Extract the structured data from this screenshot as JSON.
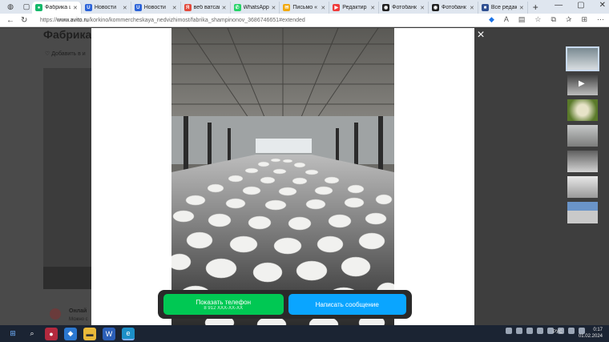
{
  "browser": {
    "tabs": [
      {
        "label": "Фабрика ш",
        "active": true,
        "fav_color": "#14b86a",
        "fav_glyph": "●"
      },
      {
        "label": "Новости",
        "fav_color": "#2b63d9",
        "fav_glyph": "U"
      },
      {
        "label": "Новости",
        "fav_color": "#2b63d9",
        "fav_glyph": "U"
      },
      {
        "label": "веб ватсап",
        "fav_color": "#e34b3d",
        "fav_glyph": "Я"
      },
      {
        "label": "WhatsApp",
        "fav_color": "#25d366",
        "fav_glyph": "✆"
      },
      {
        "label": "Письмо «",
        "fav_color": "#f2a90f",
        "fav_glyph": "✉"
      },
      {
        "label": "Редактир",
        "fav_color": "#ef3b3b",
        "fav_glyph": "▶"
      },
      {
        "label": "Фотобанк",
        "fav_color": "#222222",
        "fav_glyph": "◉"
      },
      {
        "label": "Фотобанк",
        "fav_color": "#222222",
        "fav_glyph": "◉"
      },
      {
        "label": "Все редак",
        "fav_color": "#2f4f91",
        "fav_glyph": "■"
      }
    ],
    "new_tab": "+",
    "url_prefix": "https://",
    "url_host": "www.avito.ru",
    "url_path": "/korkino/kommercheskaya_nedvizhimost/fabrika_shampinonov_3686746651#extended"
  },
  "page": {
    "title": "Фабрика",
    "favorite_link": "Добавить в и",
    "seller_status": "Онлай",
    "seller_sub": "Можно с"
  },
  "viewer": {
    "close": "×",
    "thumbnails": [
      {
        "kind": "photo",
        "active": true
      },
      {
        "kind": "video"
      },
      {
        "kind": "photo"
      },
      {
        "kind": "photo"
      },
      {
        "kind": "photo"
      },
      {
        "kind": "photo"
      },
      {
        "kind": "photo"
      }
    ],
    "phone_button": {
      "label": "Показать телефон",
      "number": "8 912 XXX-XX-XX"
    },
    "message_button": {
      "label": "Написать сообщение"
    }
  },
  "taskbar": {
    "lang": "РУС",
    "time": "0:17",
    "date": "01.02.2024"
  },
  "colors": {
    "accent_green": "#00c853",
    "accent_blue": "#0aa5ff",
    "taskbar": "#1b2433"
  }
}
